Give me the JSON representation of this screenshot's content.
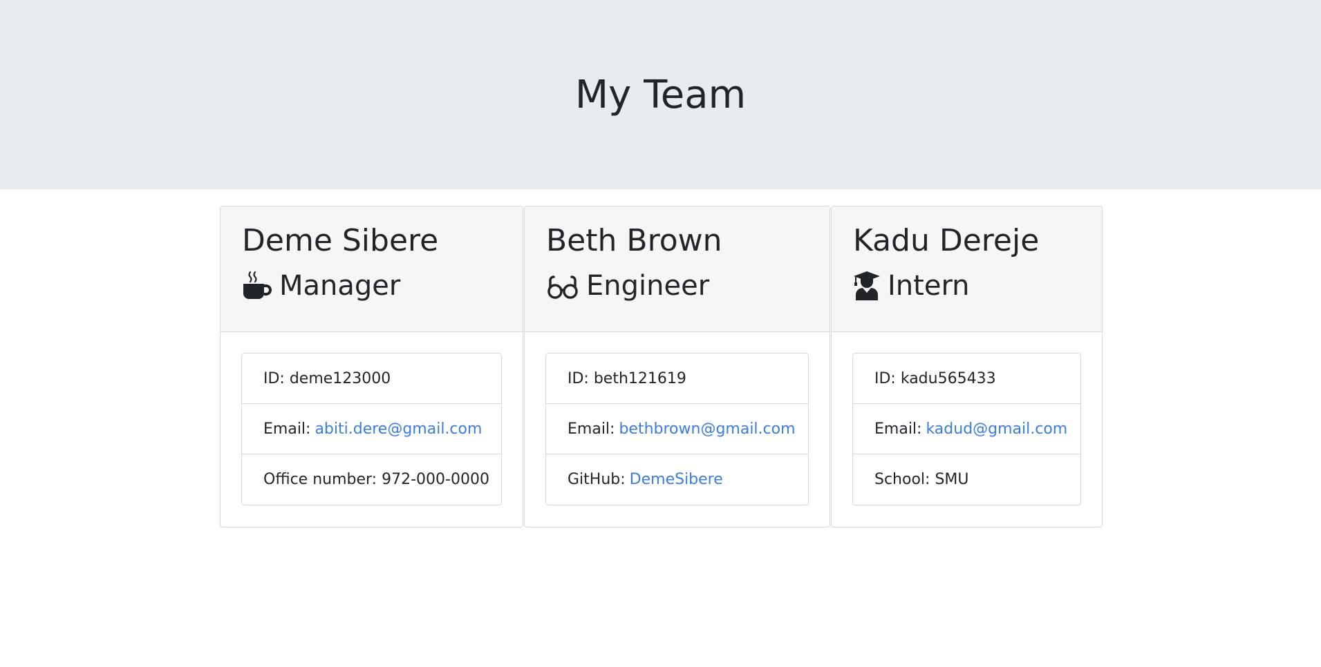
{
  "header": {
    "title": "My Team"
  },
  "team": [
    {
      "name": "Deme Sibere",
      "role": "Manager",
      "role_icon": "coffee-icon",
      "id_label": "ID: deme123000",
      "email_label": "Email:",
      "email": "abiti.dere@gmail.com",
      "extra_label": "Office number: 972-000-0000",
      "extra_link": ""
    },
    {
      "name": "Beth Brown",
      "role": "Engineer",
      "role_icon": "glasses-icon",
      "id_label": "ID: beth121619",
      "email_label": "Email:",
      "email": "bethbrown@gmail.com",
      "extra_label": "GitHub:",
      "extra_link": "DemeSibere"
    },
    {
      "name": "Kadu Dereje",
      "role": "Intern",
      "role_icon": "graduate-icon",
      "id_label": "ID: kadu565433",
      "email_label": "Email:",
      "email": "kadud@gmail.com",
      "extra_label": "School: SMU",
      "extra_link": ""
    }
  ],
  "colors": {
    "jumbotron_bg": "#e9ecef",
    "card_header_bg": "#f6f6f6",
    "link": "#3b7ddd",
    "text": "#212529"
  }
}
